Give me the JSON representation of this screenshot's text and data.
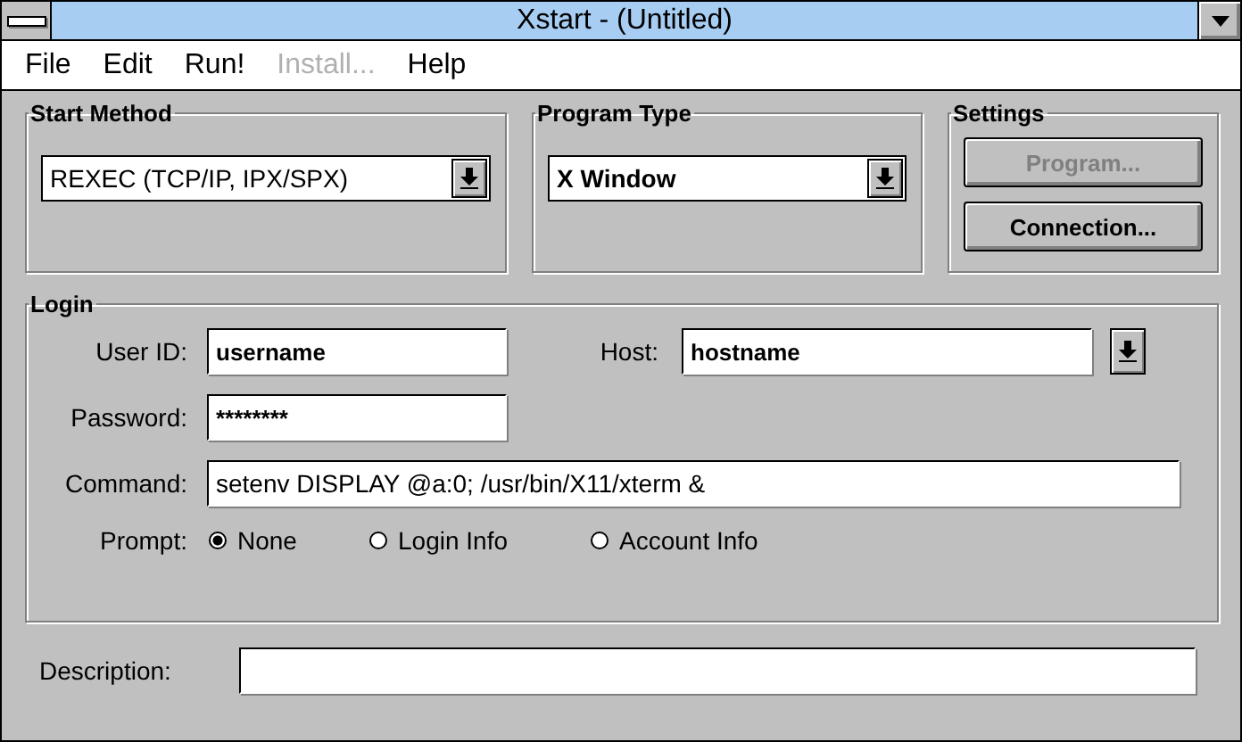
{
  "window": {
    "title": "Xstart - (Untitled)"
  },
  "menu": [
    {
      "label": "File",
      "disabled": false
    },
    {
      "label": "Edit",
      "disabled": false
    },
    {
      "label": "Run!",
      "disabled": false
    },
    {
      "label": "Install...",
      "disabled": true
    },
    {
      "label": "Help",
      "disabled": false
    }
  ],
  "start_method": {
    "title": "Start Method",
    "value": "REXEC (TCP/IP, IPX/SPX)"
  },
  "program_type": {
    "title": "Program Type",
    "value": "X Window"
  },
  "settings": {
    "title": "Settings",
    "buttons": [
      {
        "label": "Program...",
        "disabled": true
      },
      {
        "label": "Connection...",
        "disabled": false
      }
    ]
  },
  "login": {
    "title": "Login",
    "user_id": {
      "label": "User ID:",
      "value": "username"
    },
    "host": {
      "label": "Host:",
      "value": "hostname"
    },
    "password": {
      "label": "Password:",
      "value": "********"
    },
    "command": {
      "label": "Command:",
      "value": "setenv DISPLAY @a:0; /usr/bin/X11/xterm &"
    },
    "prompt": {
      "label": "Prompt:",
      "options": [
        {
          "label": "None",
          "selected": true
        },
        {
          "label": "Login Info",
          "selected": false
        },
        {
          "label": "Account Info",
          "selected": false
        }
      ]
    }
  },
  "description": {
    "label": "Description:"
  }
}
